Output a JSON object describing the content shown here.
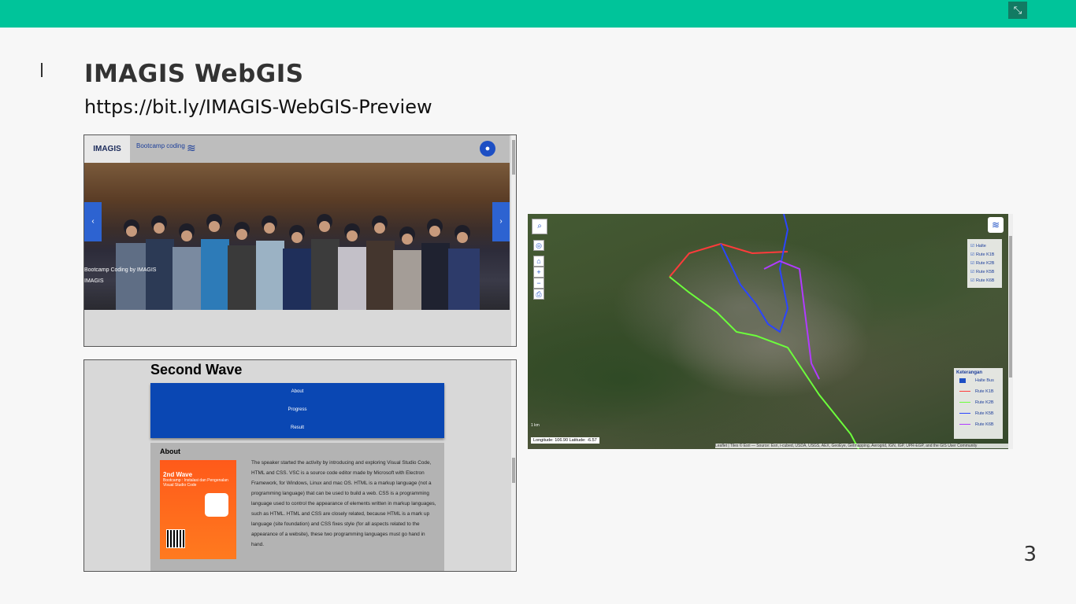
{
  "slide": {
    "title": "IMAGIS WebGIS",
    "url": "https://bit.ly/IMAGIS-WebGIS-Preview",
    "page_number": "3",
    "colors": {
      "topbar": "#00c49a",
      "nav_blue": "#0a47b3"
    }
  },
  "site1": {
    "logo": "IMAGIS",
    "bootcamp": "Bootcamp coding",
    "caption": "Bootcamp Coding by IMAGIS",
    "caption_logo": "IMAGIS",
    "arrow_left": "‹",
    "arrow_right": "›"
  },
  "site2": {
    "heading": "Second Wave",
    "menu": [
      "About",
      "Progress",
      "Result"
    ],
    "about_title": "About",
    "poster_title": "2nd Wave",
    "poster_sub": "Bootcamp : Instalasi dan Pengenalan Visual Studio Code",
    "body": "The speaker started the activity by introducing and exploring Visual Studio Code, HTML and CSS. VSC is a source code editor made by Microsoft with Electron Framework, for Windows, Linux and mac OS. HTML is a markup language (not a programming language) that can be used to build a web. CSS is a programming language used to control the appearance of elements written in markup languages, such as HTML. HTML and CSS are closely related, because HTML is a mark up language (site foundation) and CSS fixes style (for all aspects related to the appearance of a website), these two programming languages must go hand in hand."
  },
  "map": {
    "layers_top": [
      "Halte",
      "Rute K1B",
      "Rute K2B",
      "Rute K5B",
      "Rute K6B"
    ],
    "legend_title": "Keterangan",
    "legend": [
      {
        "label": "Halte Bus",
        "color": "#1d4fc4"
      },
      {
        "label": "Rute K1B",
        "color": "#ff3b3b"
      },
      {
        "label": "Rute K2B",
        "color": "#6cff3b"
      },
      {
        "label": "Rute K5B",
        "color": "#2b45ff"
      },
      {
        "label": "Rute K6B",
        "color": "#b13bff"
      }
    ],
    "coords": "Longitude: 106.90 Latitude: -6.57",
    "attribution": "Leaflet | Tiles © Esri — Source: Esri, i-cubed, USDA, USGS, AEX, GeoEye, Getmapping, Aerogrid, IGN, IGP, UPR-EGP, and the GIS User Community",
    "scale": "1 km"
  }
}
